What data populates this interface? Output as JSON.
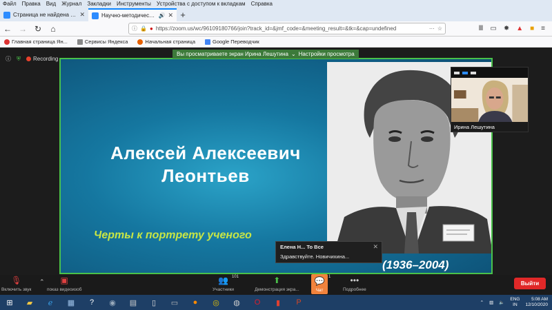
{
  "menubar": {
    "items": [
      "Файл",
      "Правка",
      "Вид",
      "Журнал",
      "Закладки",
      "Инструменты",
      "Устройства с доступом к вкладкам",
      "Справка"
    ]
  },
  "tabs": [
    {
      "title": "Страница не найдена - Zoom",
      "active": false
    },
    {
      "title": "Научно-методический семинар",
      "active": true
    }
  ],
  "address": {
    "url": "https://zoom.us/wc/96109180766/join?track_id=&jmf_code=&meeting_result=&tk=&cap=undefined"
  },
  "bookmarks": [
    "Главная страница Ян...",
    "Сервисы Яндекса",
    "Начальная страница",
    "Google Переводчик"
  ],
  "zoom": {
    "recording_label": "Recording",
    "viewing_banner": "Вы просматриваете экран Ирина Лешутина",
    "view_settings": "Настройки просмотра"
  },
  "slide": {
    "name_line1": "Алексей Алексеевич",
    "name_line2": "Леонтьев",
    "subtitle": "Черты к портрету ученого",
    "years": "(1936–2004)"
  },
  "video": {
    "participant_name": "Ирина Лешутина"
  },
  "chat_popup": {
    "from": "Елена Н... То Все",
    "message": "Здравствуйте. Новичихина..."
  },
  "toolbar": {
    "mute_label": "Включить звук",
    "video_label": "показ видеоизоб",
    "participants_label": "Участники",
    "participants_count": "101",
    "share_label": "Демонстрация экра...",
    "chat_label": "Чат",
    "chat_count": "1",
    "more_label": "Подробнее",
    "exit_label": "Выйти"
  },
  "taskbar": {
    "lang_line1": "ENG",
    "lang_line2": "IN",
    "time": "5:08 AM",
    "date": "12/10/2020"
  },
  "colors": {
    "zoom_green": "#4ac24a",
    "exit_red": "#e02828",
    "chat_orange": "#f1833d",
    "taskbar": "#1e3f66"
  }
}
